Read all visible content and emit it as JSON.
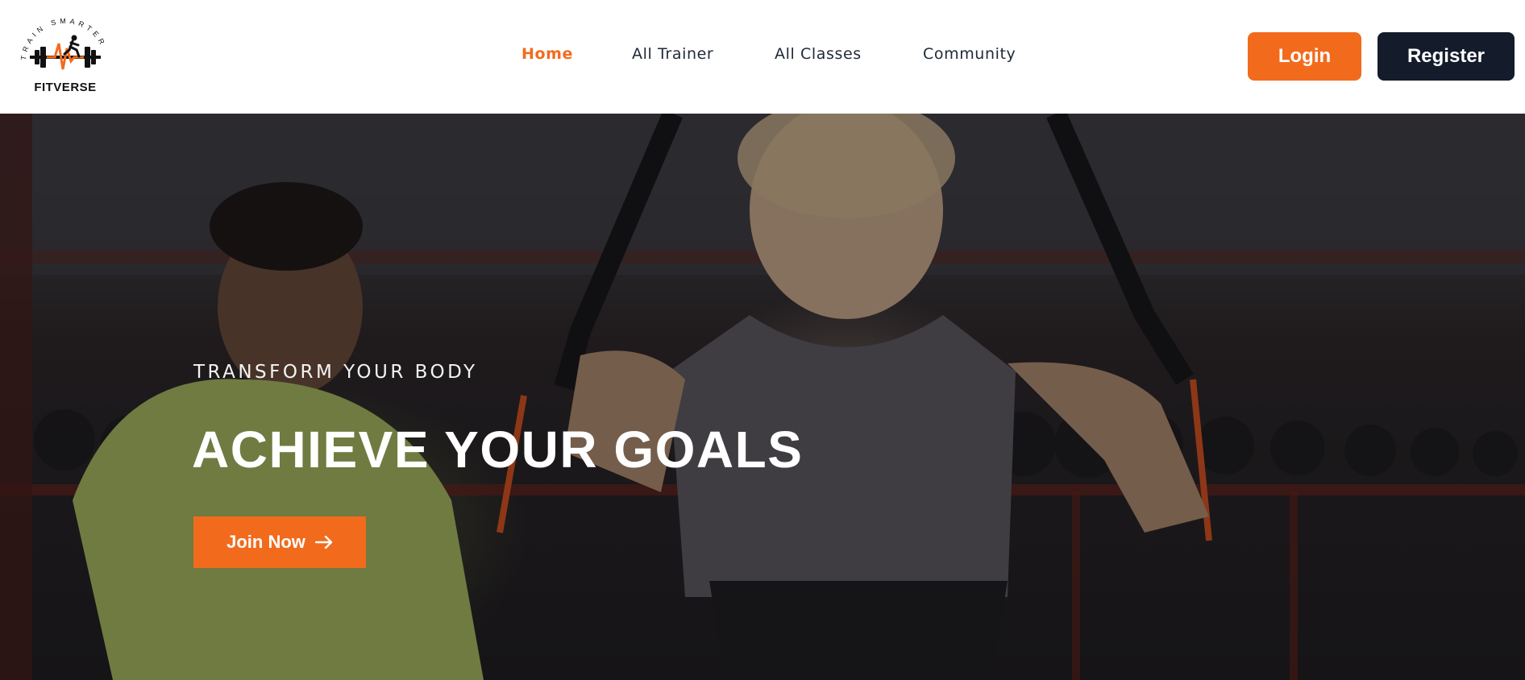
{
  "brand": {
    "name": "FITVERSE",
    "tagline": "TRAIN SMARTER",
    "logo_icon": "dumbbell-runner-icon"
  },
  "nav": {
    "items": [
      {
        "label": "Home",
        "active": true
      },
      {
        "label": "All Trainer",
        "active": false
      },
      {
        "label": "All Classes",
        "active": false
      },
      {
        "label": "Community",
        "active": false
      }
    ],
    "login_label": "Login",
    "register_label": "Register"
  },
  "hero": {
    "eyebrow": "TRANSFORM YOUR BODY",
    "title": "ACHIEVE YOUR GOALS",
    "cta_label": "Join Now",
    "cta_icon": "arrow-right-icon",
    "background_image": "gym-trainer-woman-suspension-training-photo"
  },
  "colors": {
    "accent": "#f26b1d",
    "dark": "#141c2b",
    "nav_text": "#1f2937"
  }
}
